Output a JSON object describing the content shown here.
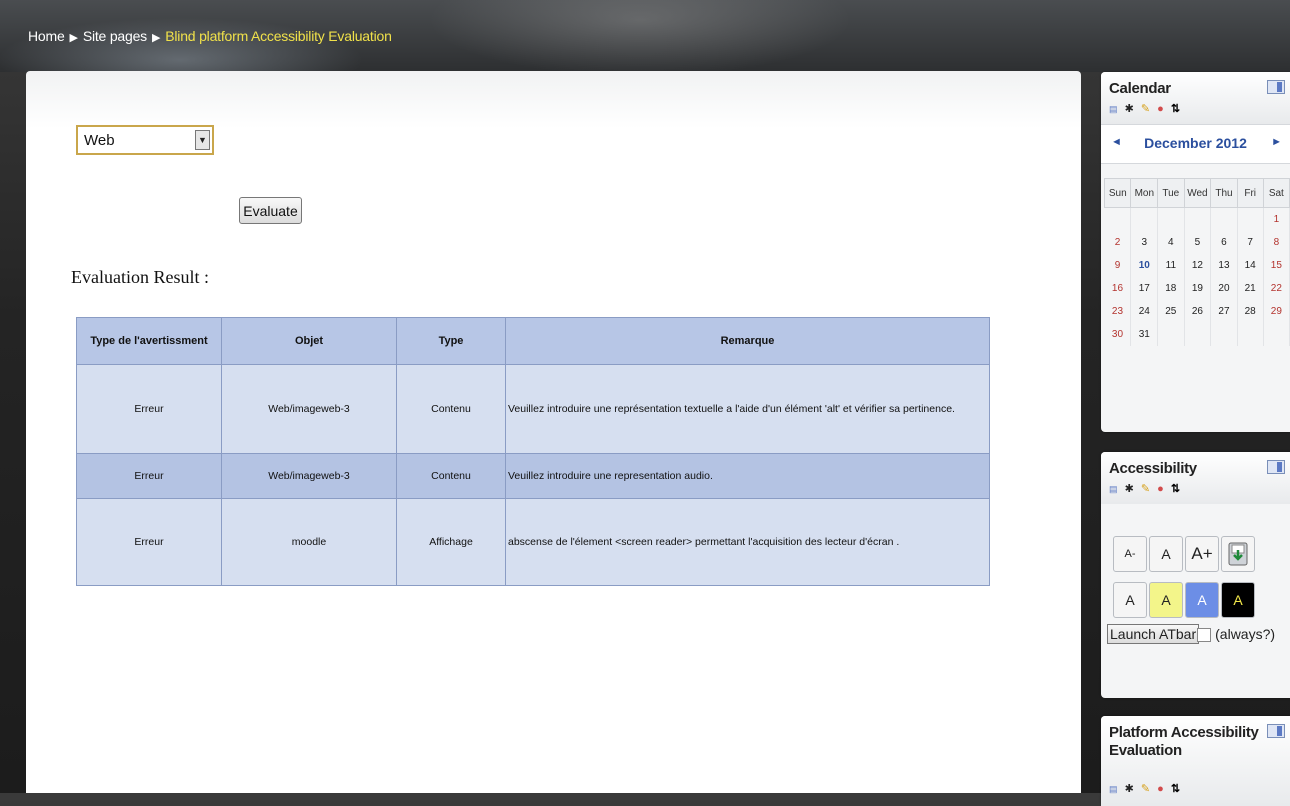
{
  "breadcrumb": {
    "home": "Home",
    "site_pages": "Site pages",
    "current": "Blind platform Accessibility Evaluation",
    "separator": "▶"
  },
  "form": {
    "platform_select_value": "Web",
    "evaluate_label": "Evaluate"
  },
  "result": {
    "title": "Evaluation Result :",
    "headers": [
      "Type de l'avertissment",
      "Objet",
      "Type",
      "Remarque"
    ],
    "rows": [
      [
        "Erreur",
        "Web/imageweb-3",
        "Contenu",
        "Veuillez introduire une représentation textuelle a l'aide d'un élément 'alt' et vérifier sa pertinence."
      ],
      [
        "Erreur",
        "Web/imageweb-3",
        "Contenu",
        "Veuillez introduire une representation audio."
      ],
      [
        "Erreur",
        "moodle",
        "Affichage",
        "abscense de l'élement <screen reader> permettant l'acquisition des lecteur d'écran ."
      ]
    ]
  },
  "calendar": {
    "title": "Calendar",
    "month": "December 2012",
    "prev": "◄",
    "next": "►",
    "weekdays": [
      "Sun",
      "Mon",
      "Tue",
      "Wed",
      "Thu",
      "Fri",
      "Sat"
    ],
    "weeks": [
      [
        "",
        "",
        "",
        "",
        "",
        "",
        "1"
      ],
      [
        "2",
        "3",
        "4",
        "5",
        "6",
        "7",
        "8"
      ],
      [
        "9",
        "10",
        "11",
        "12",
        "13",
        "14",
        "15"
      ],
      [
        "16",
        "17",
        "18",
        "19",
        "20",
        "21",
        "22"
      ],
      [
        "23",
        "24",
        "25",
        "26",
        "27",
        "28",
        "29"
      ],
      [
        "30",
        "31",
        "",
        "",
        "",
        "",
        ""
      ]
    ],
    "today": "10"
  },
  "accessibility": {
    "title": "Accessibility",
    "text_size_buttons": [
      "A-",
      "A",
      "A+"
    ],
    "save_icon": "save-settings-icon",
    "color_schemes": [
      {
        "label": "A",
        "bg": "#f5f5f5",
        "fg": "#222222"
      },
      {
        "label": "A",
        "bg": "#f3f58a",
        "fg": "#222222"
      },
      {
        "label": "A",
        "bg": "#6c8ee6",
        "fg": "#ffffff"
      },
      {
        "label": "A",
        "bg": "#000000",
        "fg": "#f3e84a"
      }
    ],
    "launch_label": "Launch ATbar",
    "always_label": "(always?)"
  },
  "platform_block": {
    "title": "Platform Accessibility Evaluation"
  },
  "block_icons": [
    "permissions-icon",
    "hide-icon",
    "edit-icon",
    "delete-icon",
    "move-icon"
  ],
  "colors": {
    "breadcrumb_current": "#f0e14a",
    "table_header": "#b7c6e6",
    "table_cell": "#d6dff0",
    "table_alt": "#b4c3e3",
    "link_blue": "#2b4f9e",
    "weekend_red": "#b3332e"
  }
}
